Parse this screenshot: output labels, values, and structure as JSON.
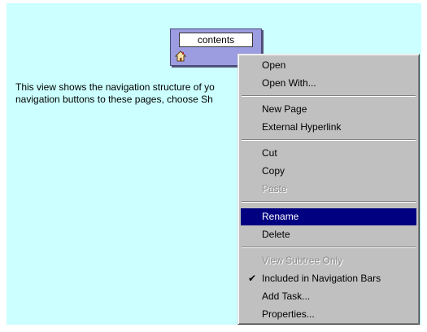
{
  "nav_view": {
    "node_label": "contents",
    "description_lines": [
      "This view shows the navigation structure of yo",
      "navigation buttons to these pages, choose Sh"
    ]
  },
  "context_menu": {
    "items": [
      {
        "label": "Open",
        "disabled": false
      },
      {
        "label": "Open With...",
        "disabled": false
      },
      {
        "label": "New Page",
        "disabled": false
      },
      {
        "label": "External Hyperlink",
        "disabled": false
      },
      {
        "label": "Cut",
        "disabled": false
      },
      {
        "label": "Copy",
        "disabled": false
      },
      {
        "label": "Paste",
        "disabled": true
      },
      {
        "label": "Rename",
        "disabled": false,
        "selected": true
      },
      {
        "label": "Delete",
        "disabled": false
      },
      {
        "label": "View Subtree Only",
        "disabled": true
      },
      {
        "label": "Included in Navigation Bars",
        "disabled": false,
        "checked": true
      },
      {
        "label": "Add Task...",
        "disabled": false
      },
      {
        "label": "Properties...",
        "disabled": false
      }
    ]
  },
  "colors": {
    "canvas_background": "#ccffff",
    "menu_background": "#c0c0c0",
    "selection": "#000080",
    "node_fill": "#9c9ce0"
  },
  "icons": {
    "node_icon": "home-icon",
    "check_mark": "check-icon"
  }
}
